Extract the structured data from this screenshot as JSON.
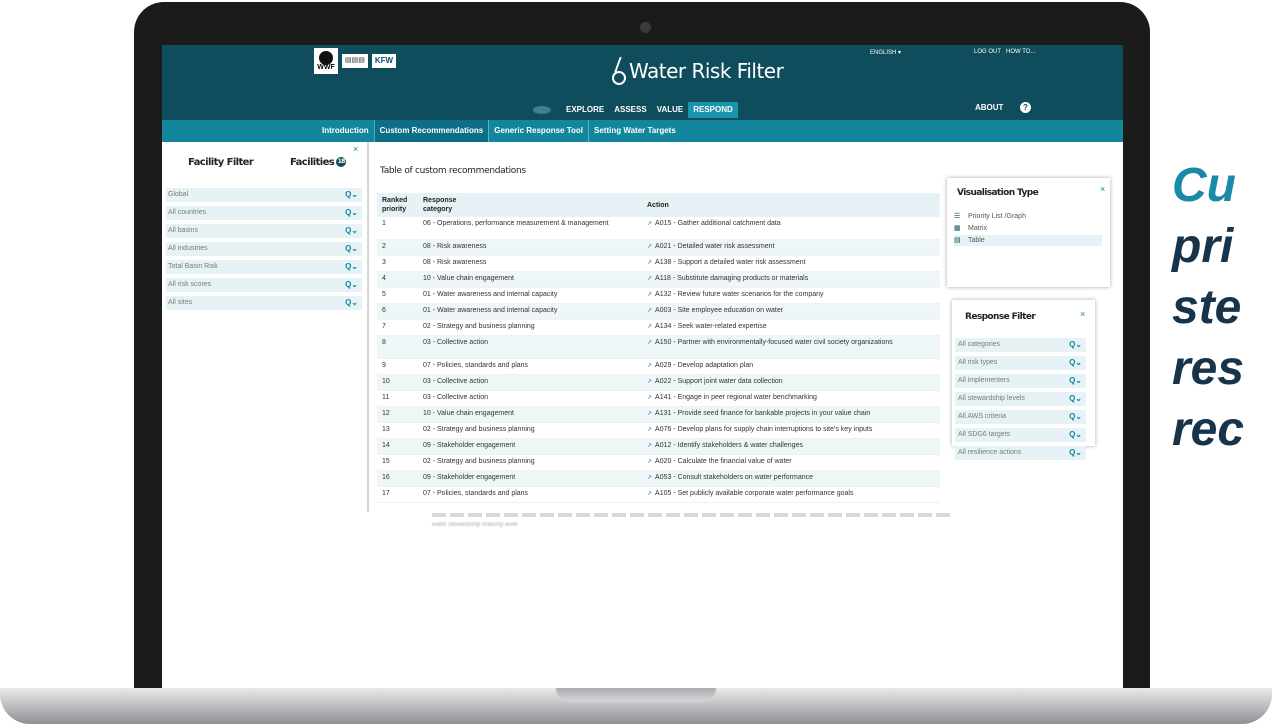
{
  "slide_text": [
    "Cu",
    "pri",
    "ste",
    "res",
    "rec"
  ],
  "header": {
    "logos": {
      "wwf": "WWF",
      "small": "kfw_small",
      "kfw": "KFW"
    },
    "brand_title": "Water Risk Filter",
    "language": "ENGLISH ▾",
    "logout": "LOG OUT",
    "howto": "HOW TO...",
    "nav": [
      "EXPLORE",
      "ASSESS",
      "VALUE",
      "RESPOND"
    ],
    "nav_active": "RESPOND",
    "about": "ABOUT",
    "help": "?"
  },
  "subnav": {
    "tabs": [
      "Introduction",
      "Custom Recommendations",
      "Generic Response Tool",
      "Setting Water Targets"
    ]
  },
  "sidebar": {
    "tab_filter": "Facility Filter",
    "tab_facilities": "Facilities",
    "facilities_count": "18",
    "close": "×",
    "filters": [
      "Global",
      "All countries",
      "All basins",
      "All industries",
      "Total Basin Risk",
      "All risk scores",
      "All sites"
    ]
  },
  "main": {
    "title": "Table of custom recommendations",
    "headers": {
      "rank": "Ranked priority",
      "category": "Response category",
      "action": "Action"
    },
    "rows": [
      {
        "rank": "1",
        "category": "06 - Operations, performance measurement & management",
        "action": "A015 - Gather additional catchment data"
      },
      {
        "rank": "2",
        "category": "08 - Risk awareness",
        "action": "A021 - Detailed water risk assessment"
      },
      {
        "rank": "3",
        "category": "08 - Risk awareness",
        "action": "A138 - Support a detailed water risk assessment"
      },
      {
        "rank": "4",
        "category": "10 - Value chain engagement",
        "action": "A118 - Substitute damaging products or materials"
      },
      {
        "rank": "5",
        "category": "01 - Water awareness and internal capacity",
        "action": "A132 - Review future water scenarios for the company"
      },
      {
        "rank": "6",
        "category": "01 - Water awareness and internal capacity",
        "action": "A003 - Site employee education on water"
      },
      {
        "rank": "7",
        "category": "02 - Strategy and business planning",
        "action": "A134 - Seek water-related expertise"
      },
      {
        "rank": "8",
        "category": "03 - Collective action",
        "action": "A150 - Partner with environmentally-focused water civil society organizations"
      },
      {
        "rank": "9",
        "category": "07 - Policies, standards and plans",
        "action": "A029 - Develop adaptation plan"
      },
      {
        "rank": "10",
        "category": "03 - Collective action",
        "action": "A022 - Support joint water data collection"
      },
      {
        "rank": "11",
        "category": "03 - Collective action",
        "action": "A141 - Engage in peer regional water benchmarking"
      },
      {
        "rank": "12",
        "category": "10 - Value chain engagement",
        "action": "A131 - Provide seed finance for bankable projects in your value chain"
      },
      {
        "rank": "13",
        "category": "02 - Strategy and business planning",
        "action": "A076 - Develop plans for supply chain interruptions to site's key inputs"
      },
      {
        "rank": "14",
        "category": "09 - Stakeholder engagement",
        "action": "A012 - Identify stakeholders & water challenges"
      },
      {
        "rank": "15",
        "category": "02 - Strategy and business planning",
        "action": "A020 - Calculate the financial value of water"
      },
      {
        "rank": "16",
        "category": "09 - Stakeholder engagement",
        "action": "A053 - Consult stakeholders on water performance"
      },
      {
        "rank": "17",
        "category": "07 - Policies, standards and plans",
        "action": "A105 - Set publicly available corporate water performance goals"
      }
    ],
    "blurred_text": "water stewardship maturity level"
  },
  "visualisation": {
    "title": "Visualisation Type",
    "close": "×",
    "options": [
      "Priority List /Graph",
      "Matrix",
      "Table"
    ],
    "selected": "Table"
  },
  "response_filter": {
    "title": "Response Filter",
    "close": "×",
    "filters": [
      "All categories",
      "All risk types",
      "All implementers",
      "All stewardship levels",
      "All AWS criteria",
      "All SDG6 targets",
      "All resilience actions"
    ]
  },
  "colors": {
    "header": "#0f4d5c",
    "subnav": "#12869d",
    "accent": "#1a93ad",
    "row_alt": "#eef6f8",
    "slide_dark": "#17344b",
    "slide_light": "#1a8aa8"
  }
}
